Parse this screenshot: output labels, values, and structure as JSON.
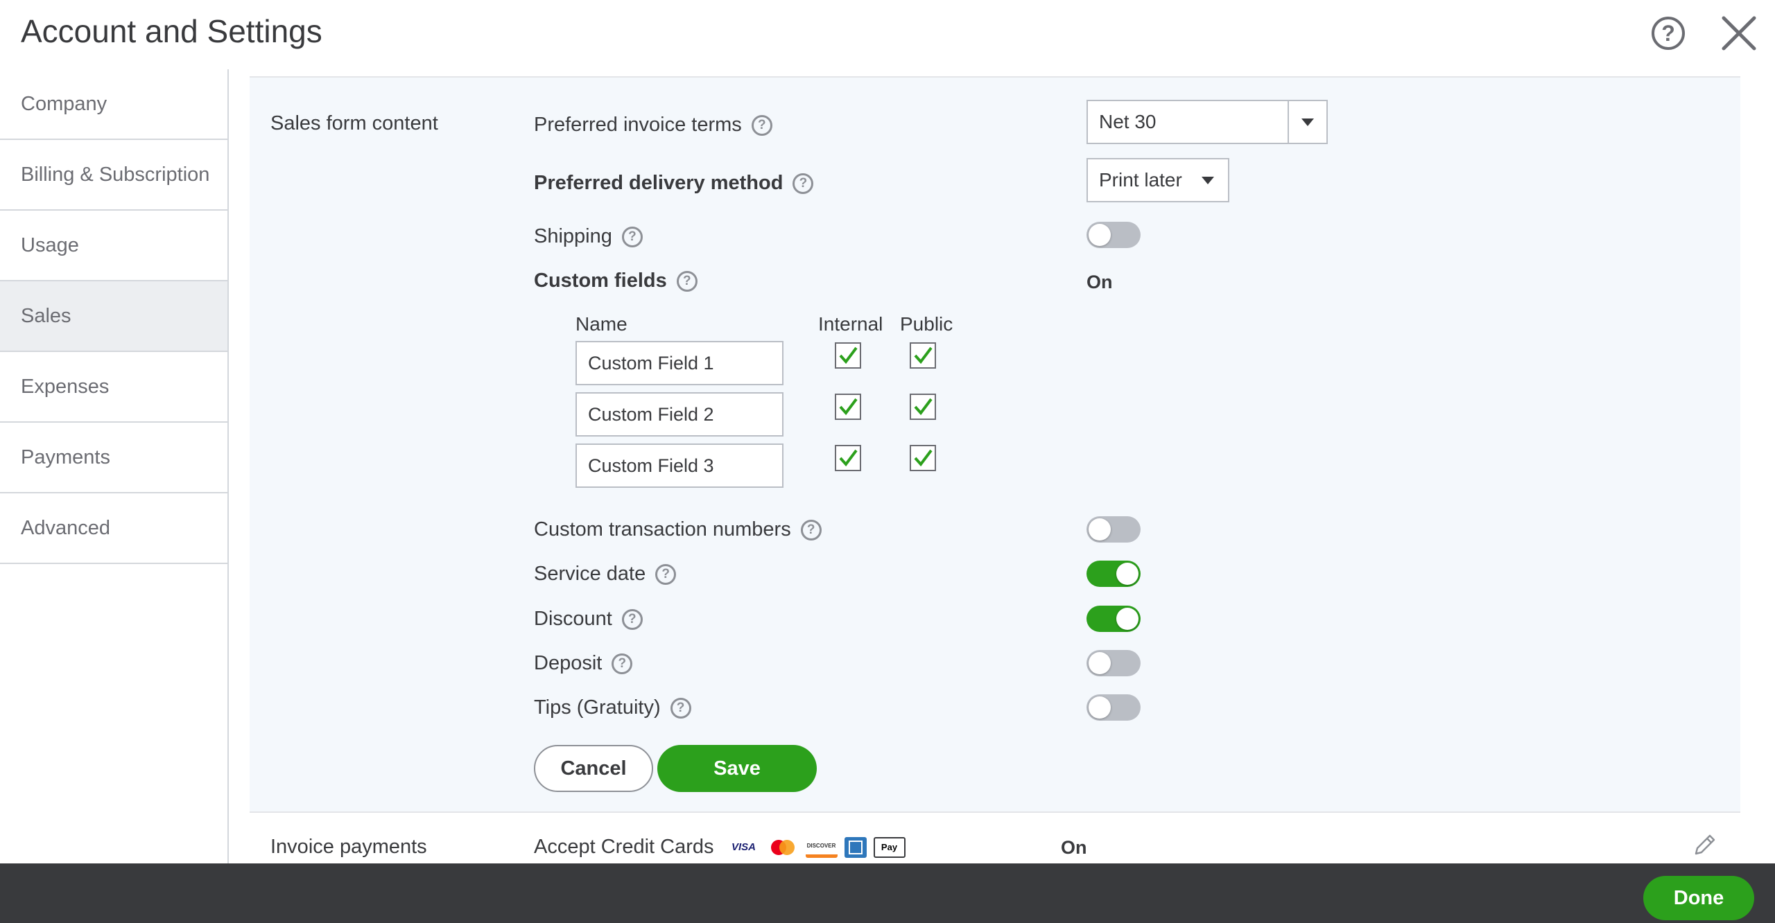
{
  "header": {
    "title": "Account and Settings",
    "help_glyph": "?"
  },
  "sidebar": {
    "items": [
      {
        "label": "Company"
      },
      {
        "label": "Billing & Subscription"
      },
      {
        "label": "Usage"
      },
      {
        "label": "Sales",
        "active": true
      },
      {
        "label": "Expenses"
      },
      {
        "label": "Payments"
      },
      {
        "label": "Advanced"
      }
    ]
  },
  "sales_form": {
    "title": "Sales form content",
    "invoice_terms": {
      "label": "Preferred invoice terms",
      "value": "Net 30"
    },
    "delivery_method": {
      "label": "Preferred delivery method",
      "value": "Print later"
    },
    "shipping": {
      "label": "Shipping",
      "on": false
    },
    "custom_fields": {
      "label": "Custom fields",
      "status": "On",
      "col_name": "Name",
      "col_internal": "Internal",
      "col_public": "Public",
      "rows": [
        {
          "name": "Custom Field 1",
          "internal": true,
          "public": true
        },
        {
          "name": "Custom Field 2",
          "internal": true,
          "public": true
        },
        {
          "name": "Custom Field 3",
          "internal": true,
          "public": true
        }
      ]
    },
    "custom_txn_numbers": {
      "label": "Custom transaction numbers",
      "on": false
    },
    "service_date": {
      "label": "Service date",
      "on": true
    },
    "discount": {
      "label": "Discount",
      "on": true
    },
    "deposit": {
      "label": "Deposit",
      "on": false
    },
    "tips": {
      "label": "Tips (Gratuity)",
      "on": false
    },
    "cancel_label": "Cancel",
    "save_label": "Save"
  },
  "invoice_payments": {
    "title": "Invoice payments",
    "label": "Accept Credit Cards",
    "status": "On",
    "cards": [
      "VISA",
      "mastercard",
      "DISCOVER",
      "amex",
      "Pay"
    ]
  },
  "footer": {
    "done_label": "Done"
  },
  "colors": {
    "green": "#2ca01c",
    "footer_bg": "#393a3d",
    "section_bg": "#f4f8fc"
  }
}
